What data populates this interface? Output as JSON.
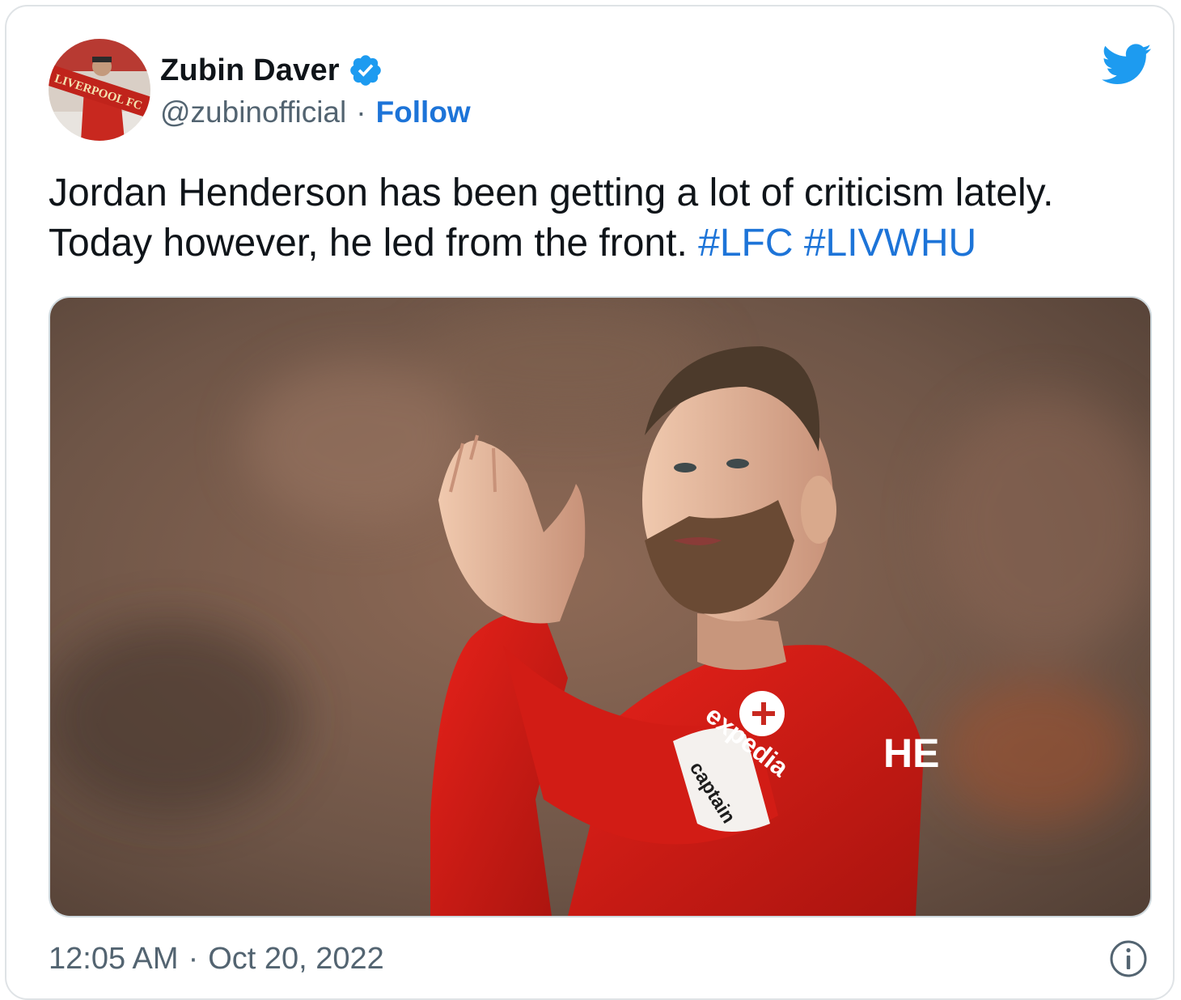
{
  "author": {
    "display_name": "Zubin Daver",
    "handle": "@zubinofficial",
    "follow_label": "Follow",
    "separator": "·",
    "avatar_scarf_text": "LIVERPOOL FC"
  },
  "tweet": {
    "text_line1": "Jordan Henderson has been getting a lot of criticism lately.",
    "text_line2": "Today however, he led from the front.",
    "hashtags": [
      "#LFC",
      "#LIVWHU"
    ]
  },
  "media": {
    "jersey_sponsor": "expedia",
    "armband_text": "captain",
    "jersey_name_fragment": "HE"
  },
  "footer": {
    "time": "12:05 AM",
    "separator": "·",
    "date": "Oct 20, 2022"
  },
  "icons": {
    "verified": "verified-badge-icon",
    "platform": "twitter-bird-icon",
    "info": "info-icon"
  },
  "colors": {
    "link": "#1d74d8",
    "twitter_blue": "#1d9bf0",
    "text": "#0f1419",
    "muted": "#536471"
  }
}
